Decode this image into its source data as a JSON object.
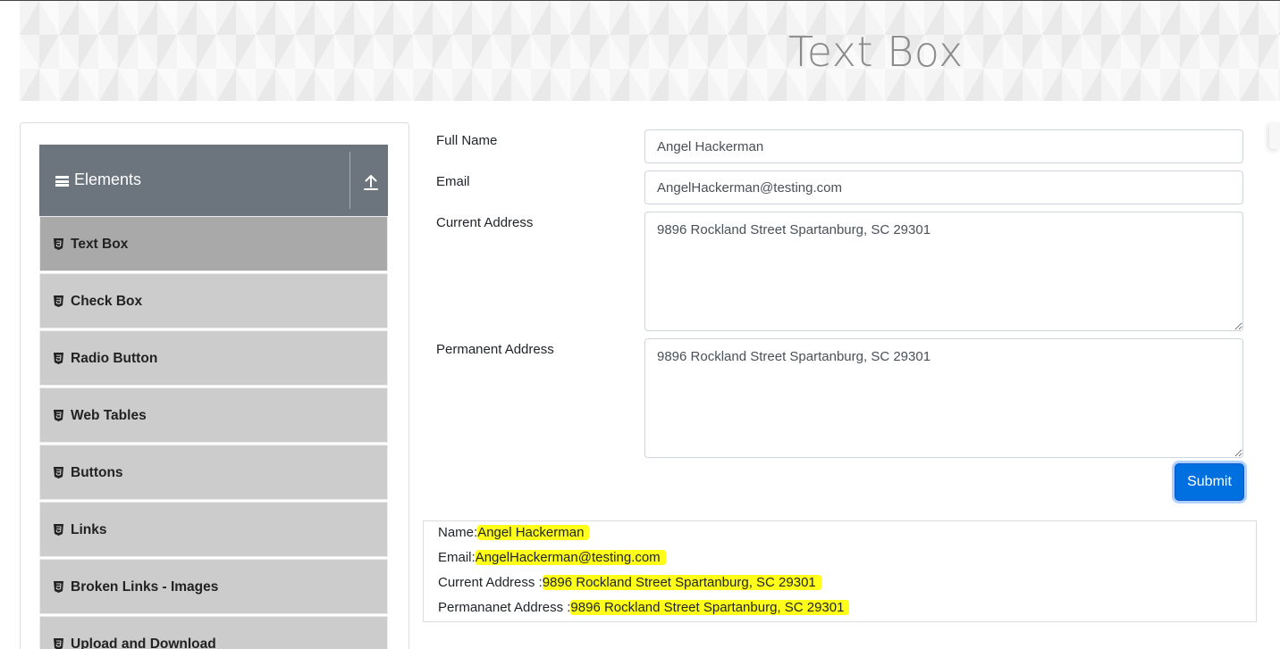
{
  "page": {
    "title": "Text Box"
  },
  "sidebar": {
    "group_title": "Elements",
    "items": [
      {
        "label": "Text Box"
      },
      {
        "label": "Check Box"
      },
      {
        "label": "Radio Button"
      },
      {
        "label": "Web Tables"
      },
      {
        "label": "Buttons"
      },
      {
        "label": "Links"
      },
      {
        "label": "Broken Links - Images"
      },
      {
        "label": "Upload and Download"
      }
    ]
  },
  "form": {
    "full_name": {
      "label": "Full Name",
      "value": "Angel Hackerman"
    },
    "email": {
      "label": "Email",
      "value": "AngelHackerman@testing.com"
    },
    "current_address": {
      "label": "Current Address",
      "value": "9896 Rockland Street Spartanburg, SC 29301"
    },
    "permanent_address": {
      "label": "Permanent Address",
      "value": "9896 Rockland Street Spartanburg, SC 29301"
    },
    "submit_label": "Submit"
  },
  "output": {
    "name_label": "Name:",
    "name_value": "Angel Hackerman",
    "email_label": "Email:",
    "email_value": "AngelHackerman@testing.com",
    "current_label": "Current Address :",
    "current_value": "9896 Rockland Street Spartanburg, SC 29301",
    "permanent_label": "Permananet Address :",
    "permanent_value": "9896 Rockland Street Spartanburg, SC 29301"
  },
  "colors": {
    "sidebar_header": "#6c757d",
    "menu_item": "#cccccc",
    "menu_item_active": "#a9a9a9",
    "submit": "#0070e0",
    "highlight": "#ffff1a"
  }
}
